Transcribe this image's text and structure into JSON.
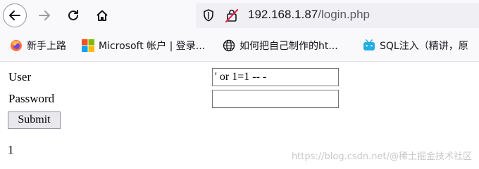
{
  "toolbar": {
    "icons": [
      "back-arrow-icon",
      "forward-arrow-icon",
      "reload-icon",
      "home-icon"
    ],
    "url_host": "192.168.1.87",
    "url_path": "/login.php",
    "url_icons": [
      "shield-icon",
      "insecure-lock-icon"
    ]
  },
  "bookmarks": [
    {
      "label": "新手上路",
      "icon": "firefox-icon"
    },
    {
      "label": "Microsoft 帐户 | 登录...",
      "icon": "microsoft-logo-icon"
    },
    {
      "label": "如何把自己制作的ht...",
      "icon": "globe-icon"
    },
    {
      "label": "SQL注入（精讲，原",
      "icon": "bilibili-icon"
    }
  ],
  "form": {
    "user_label": "User",
    "user_value": "' or 1=1 -- -",
    "password_label": "Password",
    "password_value": "",
    "submit_label": "Submit"
  },
  "result": "1",
  "watermark": "https://blog.csdn.net/@稀土掘金技术社区",
  "colors": {
    "insecure_lock": "#e22850",
    "toolbar_bg": "#f9f9fb",
    "urlbar_bg": "#f0f0f4"
  }
}
